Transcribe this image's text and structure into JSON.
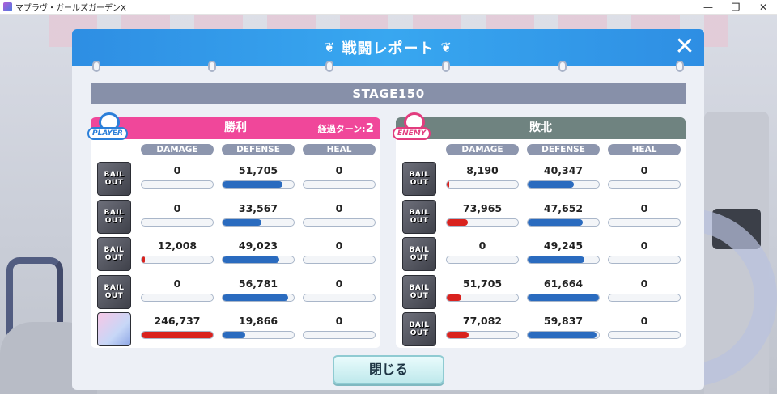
{
  "window": {
    "title": "マブラヴ・ガールズガーデンX",
    "minimize": "—",
    "maximize": "❐",
    "close": "✕"
  },
  "dialog": {
    "title": "戦闘レポート",
    "close_icon": "✕",
    "stage": "STAGE150",
    "close_button": "閉じる"
  },
  "columns": [
    "DAMAGE",
    "DEFENSE",
    "HEAL"
  ],
  "player": {
    "badge": "PLAYER",
    "result": "勝利",
    "turns_label": "経過ターン:",
    "turns_value": "2",
    "avatar_label_top": "BAIL",
    "avatar_label_bottom": "OUT",
    "rows": [
      {
        "damage": "0",
        "defense": "51,705",
        "heal": "0",
        "damage_fill": 0.0,
        "defense_fill": 0.84,
        "heal_fill": 0.0,
        "type": "bail"
      },
      {
        "damage": "0",
        "defense": "33,567",
        "heal": "0",
        "damage_fill": 0.0,
        "defense_fill": 0.54,
        "heal_fill": 0.0,
        "type": "bail"
      },
      {
        "damage": "12,008",
        "defense": "49,023",
        "heal": "0",
        "damage_fill": 0.05,
        "defense_fill": 0.8,
        "heal_fill": 0.0,
        "type": "bail"
      },
      {
        "damage": "0",
        "defense": "56,781",
        "heal": "0",
        "damage_fill": 0.0,
        "defense_fill": 0.92,
        "heal_fill": 0.0,
        "type": "bail"
      },
      {
        "damage": "246,737",
        "defense": "19,866",
        "heal": "0",
        "damage_fill": 1.0,
        "defense_fill": 0.32,
        "heal_fill": 0.0,
        "type": "char"
      }
    ]
  },
  "enemy": {
    "badge": "ENEMY",
    "result": "敗北",
    "avatar_label_top": "BAIL",
    "avatar_label_bottom": "OUT",
    "rows": [
      {
        "damage": "8,190",
        "defense": "40,347",
        "heal": "0",
        "damage_fill": 0.03,
        "defense_fill": 0.65,
        "heal_fill": 0.0
      },
      {
        "damage": "73,965",
        "defense": "47,652",
        "heal": "0",
        "damage_fill": 0.3,
        "defense_fill": 0.77,
        "heal_fill": 0.0
      },
      {
        "damage": "0",
        "defense": "49,245",
        "heal": "0",
        "damage_fill": 0.0,
        "defense_fill": 0.8,
        "heal_fill": 0.0
      },
      {
        "damage": "51,705",
        "defense": "61,664",
        "heal": "0",
        "damage_fill": 0.21,
        "defense_fill": 1.0,
        "heal_fill": 0.0
      },
      {
        "damage": "77,082",
        "defense": "59,837",
        "heal": "0",
        "damage_fill": 0.31,
        "defense_fill": 0.97,
        "heal_fill": 0.0
      }
    ]
  },
  "colors": {
    "header_blue": "#2e8ee3",
    "player_pink": "#f0479a",
    "enemy_gray": "#6f8380",
    "damage_red": "#d9221e",
    "defense_blue": "#2a6bbf"
  }
}
